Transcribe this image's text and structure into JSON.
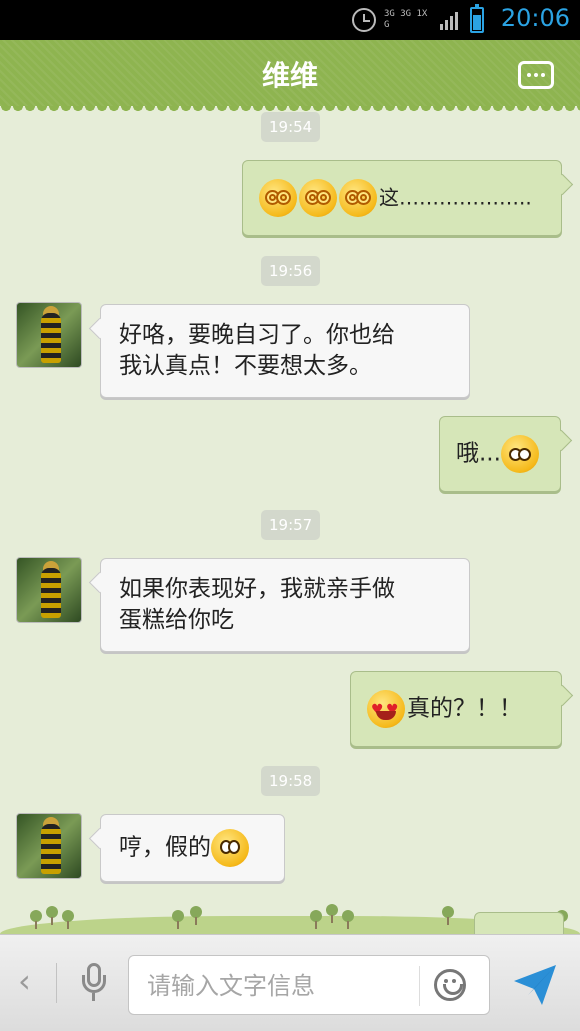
{
  "status_bar": {
    "time": "20:06",
    "network_top": "3G 3G 1X G",
    "icons": [
      "alarm-icon",
      "network-icon",
      "signal-icon",
      "battery-icon"
    ],
    "accent_color": "#2ba3e3"
  },
  "header": {
    "title": "维维",
    "menu_icon": "more-options-icon",
    "background_color": "#8eb450"
  },
  "messages": [
    {
      "type": "timestamp",
      "text": "19:54"
    },
    {
      "type": "message",
      "side": "right",
      "emojis": [
        "dizzy",
        "dizzy",
        "dizzy"
      ],
      "text": "这……………….."
    },
    {
      "type": "timestamp",
      "text": "19:56"
    },
    {
      "type": "message",
      "side": "left",
      "text_lines": [
        "好咯，要晚自习了。你也给",
        "我认真点！不要想太多。"
      ]
    },
    {
      "type": "message",
      "side": "right",
      "text": "哦...",
      "emojis_after": [
        "shy"
      ]
    },
    {
      "type": "timestamp",
      "text": "19:57"
    },
    {
      "type": "message",
      "side": "left",
      "text_lines": [
        "如果你表现好，我就亲手做",
        "蛋糕给你吃"
      ]
    },
    {
      "type": "message",
      "side": "right",
      "emojis": [
        "love"
      ],
      "text": "真的？！！"
    },
    {
      "type": "timestamp",
      "text": "19:58"
    },
    {
      "type": "message",
      "side": "left",
      "text": "哼，假的",
      "emojis_after": [
        "think"
      ]
    }
  ],
  "input_bar": {
    "placeholder": "请输入文字信息",
    "icons": [
      "back-chevron-icon",
      "microphone-icon",
      "emoji-icon",
      "send-icon"
    ],
    "back_glyph": "‹"
  }
}
